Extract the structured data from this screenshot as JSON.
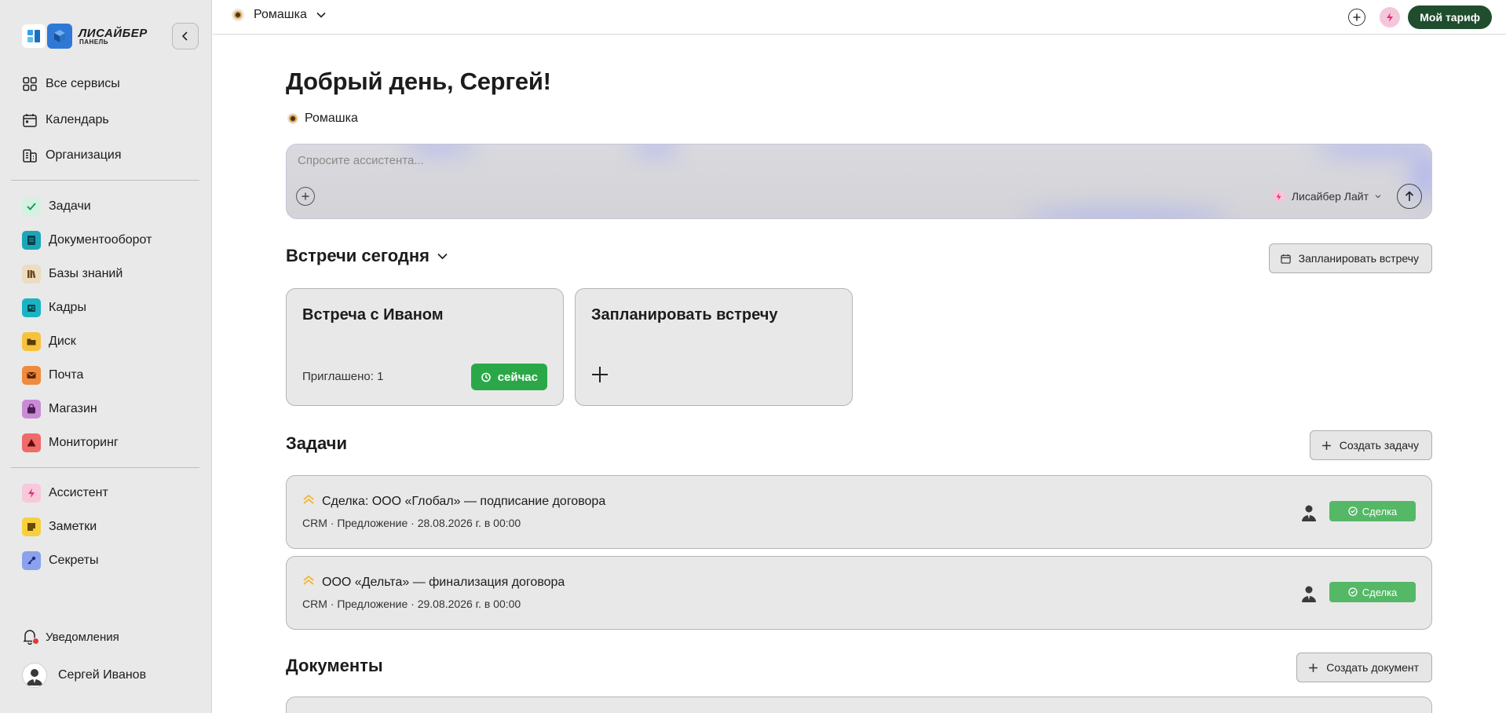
{
  "sidebar": {
    "logo": {
      "title": "ЛИСАЙБЕР",
      "subtitle": "ПАНЕЛЬ"
    },
    "top_items": [
      {
        "label": "Все сервисы",
        "icon": "grid-icon"
      },
      {
        "label": "Календарь",
        "icon": "calendar-icon"
      },
      {
        "label": "Организация",
        "icon": "building-icon"
      }
    ],
    "services": [
      {
        "label": "Задачи",
        "icon": "check-icon",
        "color": "#cfeee0"
      },
      {
        "label": "Документооборот",
        "icon": "document-icon",
        "color": "#1aa6b7"
      },
      {
        "label": "Базы знаний",
        "icon": "books-icon",
        "color": "#ead7b8"
      },
      {
        "label": "Кадры",
        "icon": "people-icon",
        "color": "#19b3c4"
      },
      {
        "label": "Диск",
        "icon": "folder-icon",
        "color": "#f6c23e"
      },
      {
        "label": "Почта",
        "icon": "mail-icon",
        "color": "#f08a3c"
      },
      {
        "label": "Магазин",
        "icon": "bag-icon",
        "color": "#c98bd4"
      },
      {
        "label": "Мониторинг",
        "icon": "warning-icon",
        "color": "#f06a6a"
      }
    ],
    "tools": [
      {
        "label": "Ассистент",
        "icon": "bolt-icon",
        "color": "#f8c8db"
      },
      {
        "label": "Заметки",
        "icon": "note-icon",
        "color": "#f6d03e"
      },
      {
        "label": "Секреты",
        "icon": "key-icon",
        "color": "#8aa2ee"
      }
    ],
    "notifications_label": "Уведомления",
    "user_name": "Сергей Иванов"
  },
  "topbar": {
    "org_name": "Ромашка",
    "tariff_label": "Мой тариф"
  },
  "main": {
    "greeting": "Добрый день, Сергей!",
    "org_name": "Ромашка",
    "assistant": {
      "placeholder": "Спросите ассистента...",
      "model": "Лисайбер Лайт"
    },
    "meetings": {
      "title": "Встречи сегодня",
      "schedule_button": "Запланировать встречу",
      "cards": [
        {
          "title": "Встреча с Иваном",
          "invited": "Приглашено: 1",
          "status": "сейчас"
        },
        {
          "title": "Запланировать встречу"
        }
      ]
    },
    "tasks": {
      "title": "Задачи",
      "create_button": "Создать задачу",
      "items": [
        {
          "title": "Сделка: ООО «Глобал» — подписание договора",
          "meta": "CRM · Предложение · 28.08.2026 г. в 00:00",
          "badge": "Сделка"
        },
        {
          "title": "ООО «Дельта» — финализация договора",
          "meta": "CRM · Предложение · 29.08.2026 г. в 00:00",
          "badge": "Сделка"
        }
      ]
    },
    "documents": {
      "title": "Документы",
      "create_button": "Создать документ"
    }
  },
  "colors": {
    "tariff_bg": "#1f4d2e",
    "now_green": "#2aa847",
    "deal_green": "#55b866",
    "priority_yellow": "#f2b632",
    "notification_dot": "#e53935"
  }
}
